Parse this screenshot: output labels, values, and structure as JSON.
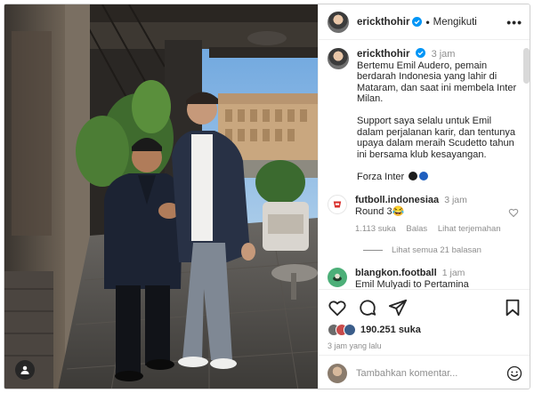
{
  "post": {
    "author": "erickthohir",
    "follow_state": "Mengikuti",
    "more_icon": "more-horizontal-icon",
    "caption": {
      "username": "erickthohir",
      "time": "3 jam",
      "paragraphs": [
        "Bertemu Emil Audero, pemain berdarah Indonesia yang lahir di Mataram, dan saat ini membela Inter Milan.",
        "Support saya selalu untuk Emil dalam perjalanan karir, dan tentunya upaya dalam meraih Scudetto tahun ini bersama klub kesayangan."
      ],
      "closing": "Forza Inter"
    }
  },
  "comments": [
    {
      "username": "futboll.indonesiaa",
      "time": "3 jam",
      "text": "Round 3😂",
      "likes": "1.113 suka",
      "reply_label": "Balas",
      "translate_label": "Lihat terjemahan",
      "view_replies": "Lihat semua 21 balasan"
    },
    {
      "username": "blangkon.football",
      "time": "1 jam",
      "text": "Emil Mulyadi to Pertamina"
    }
  ],
  "actions": {
    "likes_count": "190.251 suka",
    "time_ago": "3 jam yang lalu"
  },
  "add_comment": {
    "placeholder": "Tambahkan komentar..."
  },
  "colors": {
    "verified": "#0095f6",
    "inter_black": "#1c1c1c",
    "inter_blue": "#1f5fbf"
  }
}
